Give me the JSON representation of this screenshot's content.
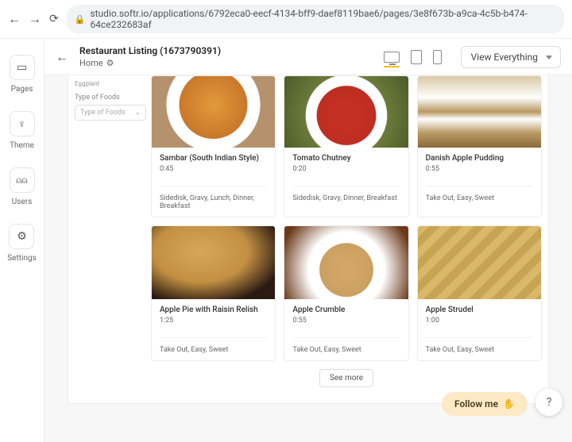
{
  "browser": {
    "url": "studio.softr.io/applications/6792eca0-eecf-4134-bff9-daef8119bae6/pages/3e8f673b-a9ca-4c5b-b474-64ce232683af"
  },
  "rail": {
    "pages": "Pages",
    "theme": "Theme",
    "users": "Users",
    "settings": "Settings"
  },
  "header": {
    "title": "Restaurant Listing (1673790391)",
    "breadcrumb": "Home",
    "view_dropdown": "View Everything"
  },
  "filters": {
    "chip": "Eggplant",
    "type_label": "Type of Foods",
    "type_dd_placeholder": "Type of Foods"
  },
  "cards": [
    {
      "title": "Sambar (South Indian Style)",
      "time": "0:45",
      "tags": "Sidedisk, Gravy, Lunch, Dinner, Breakfast",
      "img": "img-sambar"
    },
    {
      "title": "Tomato Chutney",
      "time": "0:20",
      "tags": "Sidedisk, Gravy, Dinner, Breakfast",
      "img": "img-chutney"
    },
    {
      "title": "Danish Apple Pudding",
      "time": "0:55",
      "tags": "Take Out, Easy, Sweet",
      "img": "img-pudding"
    },
    {
      "title": "Apple Pie with Raisin Relish",
      "time": "1:25",
      "tags": "Take Out, Easy, Sweet",
      "img": "img-applepie"
    },
    {
      "title": "Apple Crumble",
      "time": "0:55",
      "tags": "Take Out, Easy, Sweet",
      "img": "img-crumble"
    },
    {
      "title": "Apple Strudel",
      "time": "1:00",
      "tags": "Take Out, Easy, Sweet",
      "img": "img-strudel"
    }
  ],
  "see_more": "See more",
  "follow": "Follow me",
  "help": "?"
}
